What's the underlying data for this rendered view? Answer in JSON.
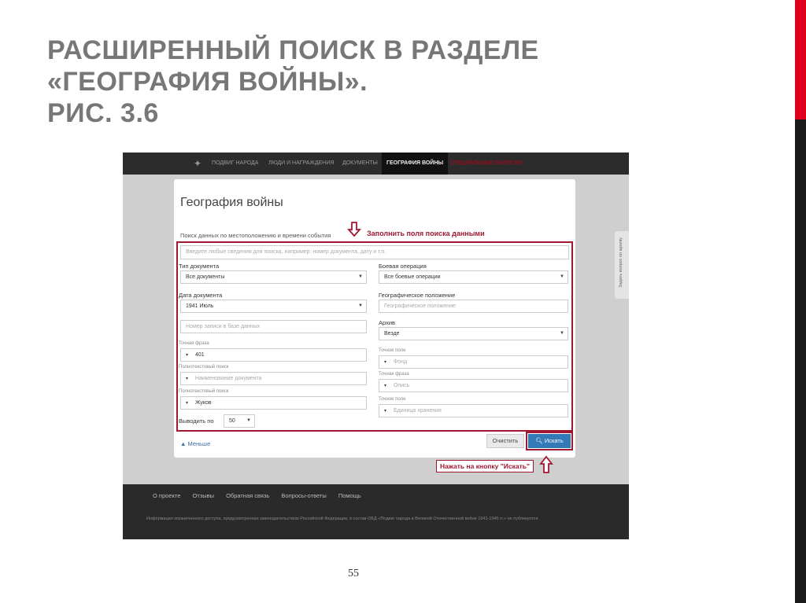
{
  "slide": {
    "title_lines": [
      "Расширенный поиск в разделе",
      "«География войны».",
      "Рис. 3.6"
    ],
    "page_number": "55"
  },
  "screenshot": {
    "nav": {
      "logo_icon": "star-emblem-icon",
      "items": [
        "ПОДВИГ НАРОДА",
        "ЛЮДИ И НАГРАЖДЕНИЯ",
        "ДОКУМЕНТЫ",
        "ГЕОГРАФИЯ ВОЙНЫ",
        "СПЕЦИАЛЬНЫЕ ВЫПУСКИ"
      ],
      "active_index": 3
    },
    "card": {
      "title": "География войны",
      "hint": "Поиск данных по местоположению и времени события",
      "fill_note": "Заполнить поля поиска данными",
      "search_placeholder": "Введите любые сведения для поиска, например: номер документа, дату и т.п."
    },
    "left": {
      "doc_type_label": "Тип документа",
      "doc_type_value": "Все документы",
      "doc_date_label": "Дата документа",
      "doc_date_value": "1941 Июль",
      "record_placeholder": "Номер записи в базе данных",
      "exact_phrase_label": "Точная фраза",
      "exact_phrase_value": "401",
      "fulltext1_label": "Полнотекстовый поиск",
      "fulltext1_placeholder": "Наименование документа",
      "fulltext2_label": "Полнотекстовый поиск",
      "fulltext2_value": "Жуков",
      "per_page_label": "Выводить по",
      "per_page_value": "50"
    },
    "right": {
      "operation_label": "Боевая операция",
      "operation_value": "Все боевые операции",
      "geo_label": "Географическое положение",
      "geo_placeholder": "Географическое положение",
      "archive_label": "Архив",
      "archive_value": "Везде",
      "exact_field1_label": "Точное поле",
      "fond_placeholder": "Фонд",
      "exact_phrase_label": "Точная фраза",
      "opis_placeholder": "Опись",
      "exact_field2_label": "Точное поле",
      "unit_placeholder": "Единица хранения"
    },
    "buttons": {
      "clear": "Очистить",
      "search": "Искать",
      "less": "▲ Меньше"
    },
    "press_note": "Нажать на кнопку \"Искать\"",
    "side_tab": "Задать вопрос по архиву",
    "footer": {
      "links": [
        "О проекте",
        "Отзывы",
        "Обратная связь",
        "Вопросы-ответы",
        "Помощь"
      ],
      "legal": "Информация ограниченного доступа, предусмотренная законодательством Российской Федерации, в состав ОБД «Подвиг народа в Великой Отечественной войне 1941-1945 гг.» не публикуется"
    }
  },
  "colors": {
    "accent_red": "#a01830",
    "edge_red": "#e0001b",
    "button_blue": "#337ab7"
  }
}
